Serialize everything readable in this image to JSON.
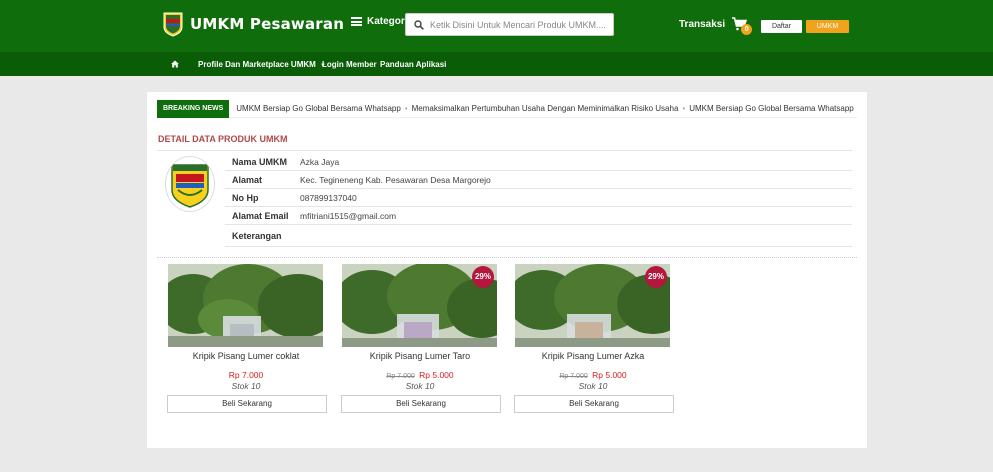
{
  "header": {
    "brand": "UMKM Pesawaran",
    "kategori": "Kategori",
    "search_placeholder": "Ketik Disini Untuk Mencari Produk UMKM....",
    "transaksi": "Transaksi",
    "cart_count": "0",
    "daftar": "Daftar",
    "umkm": "UMKM",
    "colors": {
      "primary": "#0f6e0b",
      "nav": "#0b5c07",
      "accent": "#f2a31c"
    }
  },
  "nav": {
    "home_icon": "home-icon",
    "profile": "Profile Dan Marketplace UMKM",
    "login": "Login Member",
    "panduan": "Panduan Aplikasi"
  },
  "news": {
    "label": "BREAKING NEWS",
    "items": [
      "UMKM Bersiap Go Global Bersama Whatsapp",
      "Memaksimalkan Pertumbuhan Usaha Dengan Meminimalkan Risiko Usaha",
      "UMKM Bersiap Go Global Bersama Whatsapp"
    ]
  },
  "detail": {
    "title": "DETAIL DATA PRODUK UMKM",
    "rows": [
      {
        "key": "Nama UMKM",
        "value": "Azka Jaya"
      },
      {
        "key": "Alamat",
        "value": "Kec. Tegineneng Kab. Pesawaran Desa Margorejo"
      },
      {
        "key": "No Hp",
        "value": "087899137040"
      },
      {
        "key": "Alamat Email",
        "value": "mfitriani1515@gmail.com"
      },
      {
        "key": "Keterangan",
        "value": ""
      }
    ]
  },
  "products": [
    {
      "name": "Kripik Pisang Lumer coklat",
      "old_price": "",
      "price": "Rp 7.000",
      "stok": "Stok 10",
      "discount": "",
      "button": "Beli Sekarang"
    },
    {
      "name": "Kripik Pisang Lumer Taro",
      "old_price": "Rp 7.000",
      "price": "Rp 5.000",
      "stok": "Stok 10",
      "discount": "29%",
      "button": "Beli Sekarang"
    },
    {
      "name": "Kripik Pisang Lumer Azka",
      "old_price": "Rp 7.000",
      "price": "Rp 5.000",
      "stok": "Stok 10",
      "discount": "29%",
      "button": "Beli Sekarang"
    }
  ]
}
